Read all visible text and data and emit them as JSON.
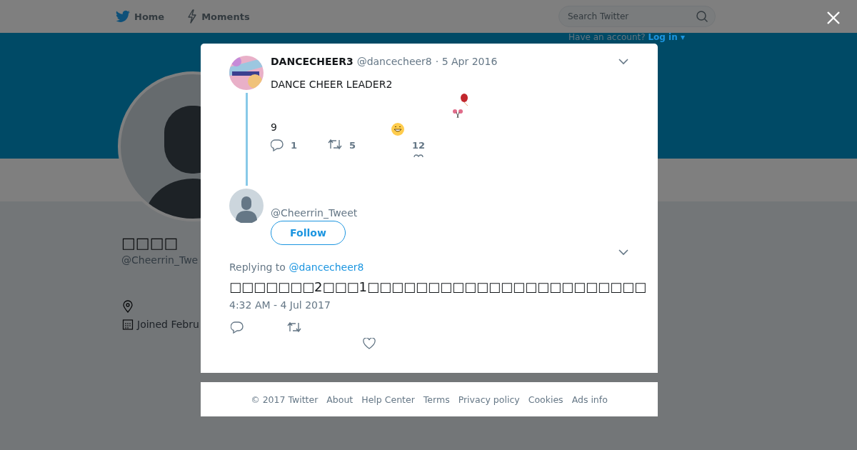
{
  "topbar": {
    "nav": [
      {
        "label": "Home",
        "kind": "bird"
      },
      {
        "label": "Moments",
        "kind": "bolt"
      }
    ],
    "search": {
      "placeholder": "Search Twitter"
    },
    "login_prompt": "Have an account?",
    "login_link": "Log in ▾"
  },
  "profile": {
    "name": "□□□□",
    "handle": "@Cheerrin_Twe",
    "joined": "Joined Febru"
  },
  "parent_tweet": {
    "name": "DANCECHEER3",
    "handle": "@dancecheer8",
    "date": "· 5 Apr 2016",
    "lines": [
      "DANCE CHEER LEADER2",
      "9"
    ],
    "replies": "1",
    "retweets": "5",
    "likes": "12"
  },
  "reply": {
    "handle": "@Cheerrin_Tweet",
    "follow": "Follow",
    "replying_label": "Replying to",
    "replying_to": "@dancecheer8",
    "text": "□□□□□□□2□□□1□□□□□□□□□□□□□□□□□□□□□□□",
    "time": "4:32 AM - 4 Jul 2017"
  },
  "footer": [
    "© 2017 Twitter",
    "About",
    "Help Center",
    "Terms",
    "Privacy policy",
    "Cookies",
    "Ads info"
  ]
}
